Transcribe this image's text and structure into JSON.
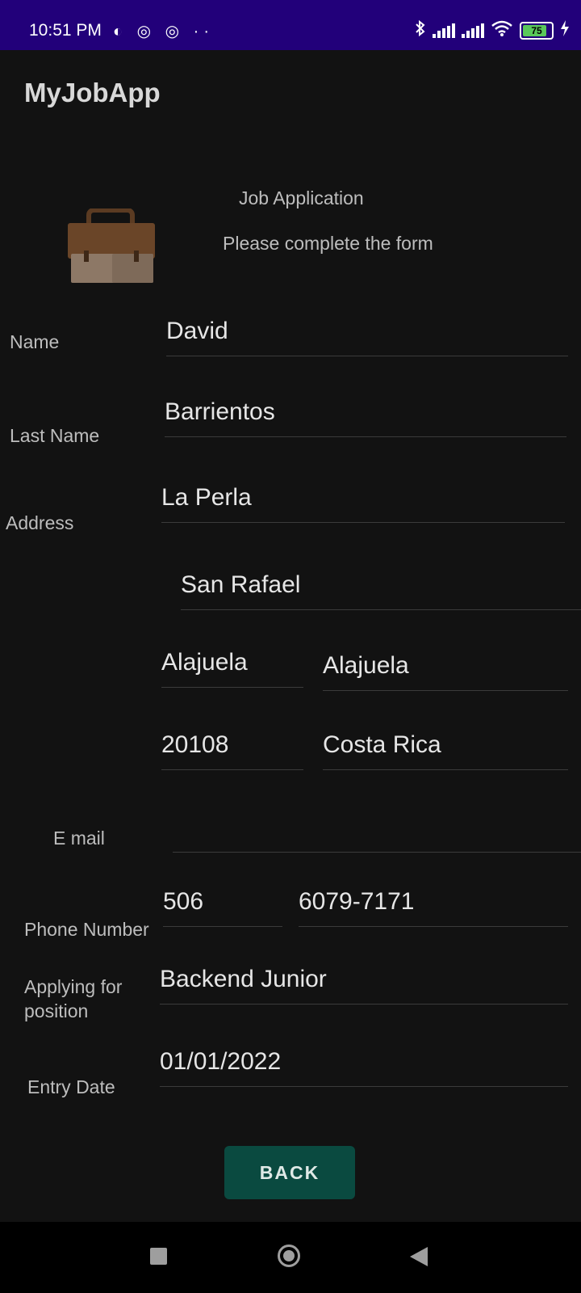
{
  "status_bar": {
    "time": "10:51 PM",
    "left_icons": "◐ ◎ ◎ ··",
    "battery": "75",
    "right_icon_names": [
      "bluetooth-icon",
      "signal-icon",
      "signal-icon",
      "wifi-icon",
      "battery-icon",
      "charging-icon"
    ]
  },
  "app_bar": {
    "title": "MyJobApp"
  },
  "header": {
    "title": "Job Application",
    "subtitle": "Please complete the form",
    "icon": "briefcase-icon"
  },
  "form": {
    "labels": {
      "name": "Name",
      "last_name": "Last Name",
      "address": "Address",
      "email": "E mail",
      "phone": "Phone Number",
      "position": "Applying for\nposition",
      "entry_date": "Entry Date"
    },
    "values": {
      "name": "David",
      "last_name": "Barrientos",
      "address_line1": "La Perla",
      "address_line2": "San Rafael",
      "city": "Alajuela",
      "state": "Alajuela",
      "zip": "20108",
      "country": "Costa Rica",
      "email": "",
      "phone_code": "506",
      "phone_number": "6079-7171",
      "position": "Backend Junior",
      "entry_date": "01/01/2022"
    }
  },
  "actions": {
    "back_label": "BACK"
  },
  "colors": {
    "status_bar": "#22007a",
    "background": "#121212",
    "button": "#0a4a40"
  }
}
